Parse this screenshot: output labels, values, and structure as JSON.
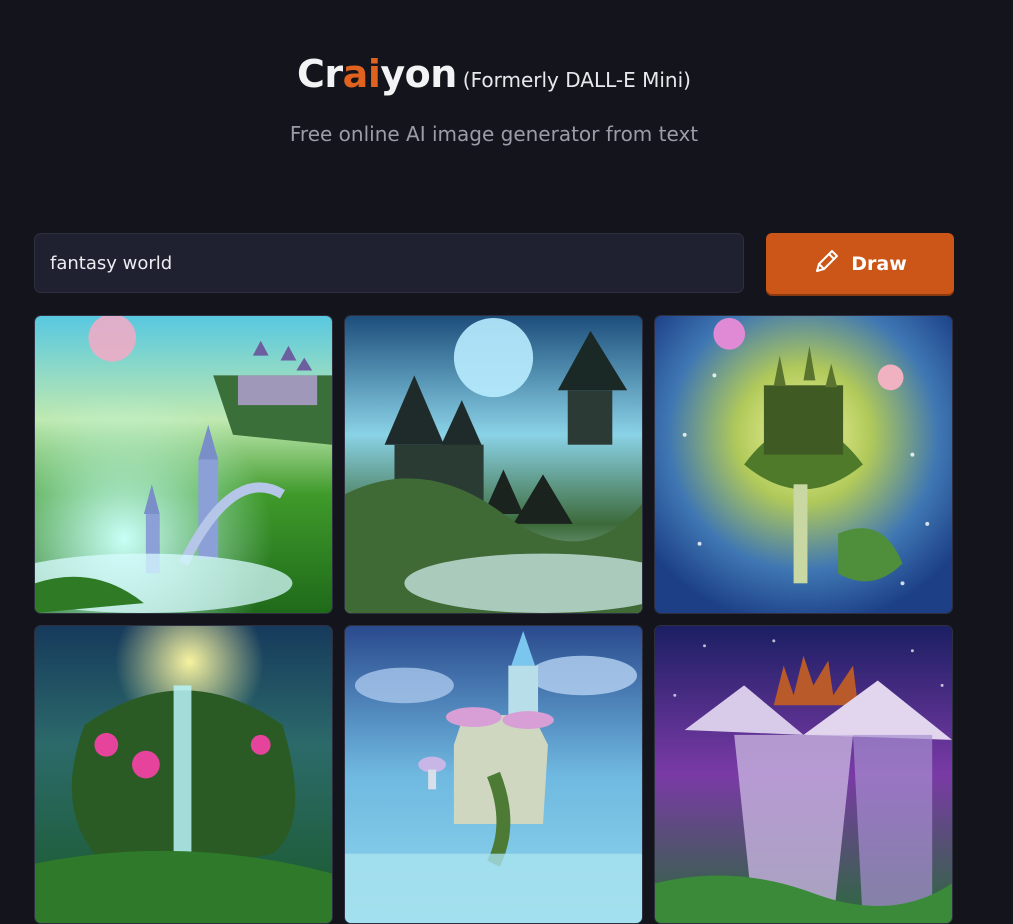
{
  "header": {
    "logo_prefix": "Cr",
    "logo_accent": "ai",
    "logo_suffix": "yon",
    "formerly": "(Formerly DALL-E Mini)",
    "subtitle": "Free online AI image generator from text"
  },
  "search": {
    "value": "fantasy world"
  },
  "draw_button": {
    "label": "Draw",
    "icon": "pencil-icon",
    "color": "#cb5617"
  },
  "colors": {
    "background": "#14151c",
    "accent": "#e0621f"
  }
}
